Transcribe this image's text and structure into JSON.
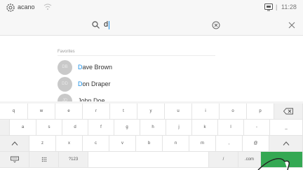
{
  "status_bar": {
    "brand": "acano",
    "separator": "|",
    "time": "11:28"
  },
  "search": {
    "value": "d"
  },
  "favorites": {
    "label": "Favorites",
    "contacts": [
      {
        "initials": "DB",
        "first_letter": "D",
        "rest": "ave Brown"
      },
      {
        "initials": "DD",
        "first_letter": "D",
        "rest": "on Draper"
      },
      {
        "initials": "JD",
        "first_letter": "",
        "rest": "John Doe"
      }
    ]
  },
  "keyboard": {
    "row1": [
      "q",
      "w",
      "e",
      "r",
      "t",
      "y",
      "u",
      "i",
      "o",
      "p"
    ],
    "row2": [
      "a",
      "s",
      "d",
      "f",
      "g",
      "h",
      "j",
      "k",
      "l",
      "-",
      "_"
    ],
    "row3": [
      "z",
      "x",
      "c",
      "v",
      "b",
      "n",
      "m",
      ",",
      "@"
    ],
    "row4": {
      "numbers": "?123",
      "slash": "/",
      "dotcom": ".com"
    }
  },
  "colors": {
    "accent": "#1b8fe6",
    "enter_key": "#34a853"
  }
}
